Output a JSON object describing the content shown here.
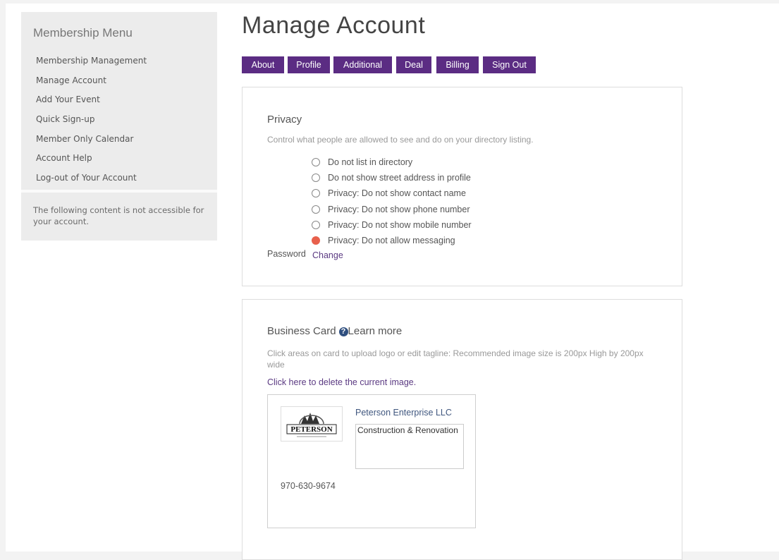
{
  "sidebar": {
    "title": "Membership Menu",
    "items": [
      {
        "label": "Membership Management"
      },
      {
        "label": "Manage Account"
      },
      {
        "label": "Add Your Event"
      },
      {
        "label": "Quick Sign-up"
      },
      {
        "label": "Member Only Calendar"
      },
      {
        "label": "Account Help"
      },
      {
        "label": "Log-out of Your Account"
      }
    ],
    "note": "The following content is not accessible for your account."
  },
  "page_title": "Manage Account",
  "tabs": [
    {
      "label": "About"
    },
    {
      "label": "Profile"
    },
    {
      "label": "Additional"
    },
    {
      "label": "Deal"
    },
    {
      "label": "Billing"
    },
    {
      "label": "Sign Out"
    }
  ],
  "privacy": {
    "heading": "Privacy",
    "description": "Control what people are allowed to see and do on your directory listing.",
    "options": [
      {
        "label": "Do not list in directory",
        "checked": false
      },
      {
        "label": "Do not show street address in profile",
        "checked": false
      },
      {
        "label": "Privacy: Do not show contact name",
        "checked": false
      },
      {
        "label": "Privacy: Do not show phone number",
        "checked": false
      },
      {
        "label": "Privacy: Do not show mobile number",
        "checked": false
      },
      {
        "label": "Privacy: Do not allow messaging",
        "checked": true
      }
    ],
    "password_label": "Password",
    "password_link": "Change"
  },
  "business_card": {
    "heading": "Business Card",
    "help_icon": "question-circle-icon",
    "learn_more": "Learn more",
    "description": "Click areas on card to upload logo or edit tagline: Recommended image size is 200px High by 200px wide",
    "delete_link": "Click here to delete the current image.",
    "company_name": "Peterson Enterprise LLC",
    "tagline": "Construction & Renovation",
    "phone": "970-630-9674",
    "logo_text": "PETERSON"
  },
  "colors": {
    "accent": "#5b2c83",
    "radio_checked": "#e8604c",
    "sidebar_bg": "#ececec"
  }
}
